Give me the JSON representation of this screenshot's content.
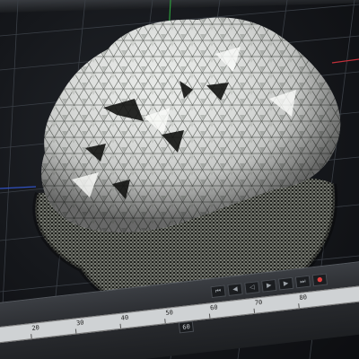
{
  "app": {
    "view": "3d-viewport",
    "object": "triangulated rock mesh"
  },
  "colors": {
    "background": "#16181c",
    "grid": "#3a3f46",
    "axis_y": "#2c9a3c",
    "axis_x": "#c0303a",
    "axis_z": "#3050c0",
    "mesh_light": "#e9ebe9",
    "mesh_dark": "#2a2c28"
  },
  "timeline": {
    "ruler_ticks": [
      "20",
      "30",
      "40",
      "50",
      "60",
      "70",
      "80"
    ],
    "current_frame": "60",
    "controls": [
      "first-frame-icon",
      "prev-key-icon",
      "play-reverse-icon",
      "play-icon",
      "next-key-icon",
      "last-frame-icon",
      "record-icon"
    ]
  }
}
